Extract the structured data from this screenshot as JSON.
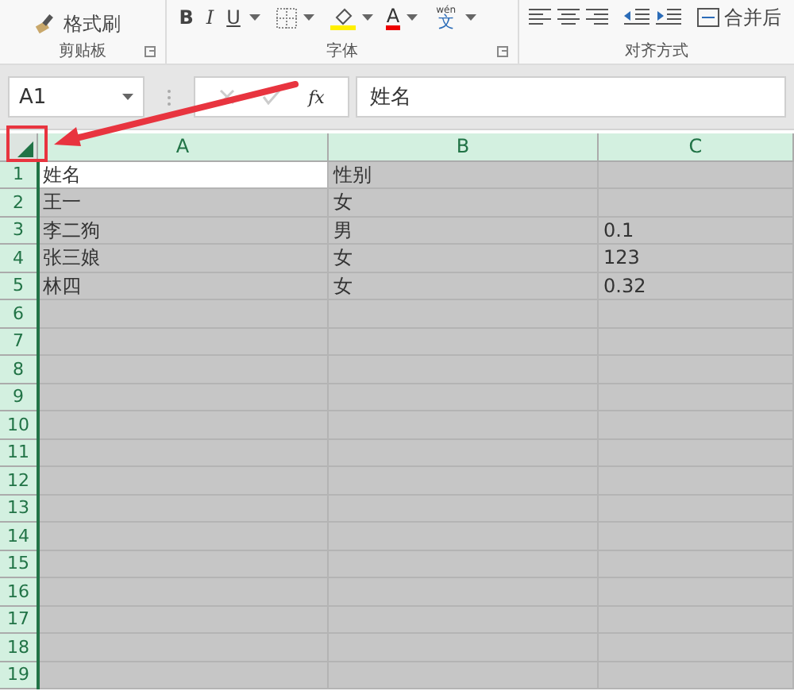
{
  "ribbon": {
    "format_painter": "格式刷",
    "bold": "B",
    "italic": "I",
    "underline": "U",
    "font_color": "A",
    "wen": "wén",
    "wen_char": "文",
    "merge": "合并后",
    "groups": [
      "剪贴板",
      "字体",
      "对齐方式"
    ]
  },
  "formula_bar": {
    "name_box": "A1",
    "fx": "fx",
    "value": "姓名"
  },
  "sheet": {
    "select_all": true,
    "columns": [
      {
        "label": "A"
      },
      {
        "label": "B"
      },
      {
        "label": "C"
      }
    ],
    "rows": [
      {
        "label": "1",
        "cells": [
          {
            "value": "姓名",
            "active": true
          },
          {
            "value": "性别",
            "active": false
          }
        ]
      },
      {
        "label": "2",
        "cells": [
          {
            "value": "王一",
            "active": false
          },
          {
            "value": "女",
            "active": false
          }
        ]
      },
      {
        "label": "3",
        "cells": [
          {
            "value": "李二狗",
            "active": false
          },
          {
            "value": "男",
            "active": false
          },
          {
            "value": "0.1",
            "active": false
          }
        ]
      },
      {
        "label": "4",
        "cells": [
          {
            "value": "张三娘",
            "active": false
          },
          {
            "value": "女",
            "active": false
          },
          {
            "value": "123",
            "active": false
          }
        ]
      },
      {
        "label": "5",
        "cells": [
          {
            "value": "林四",
            "active": false
          },
          {
            "value": "女",
            "active": false
          },
          {
            "value": "0.32",
            "active": false
          }
        ]
      },
      {
        "label": "6"
      },
      {
        "label": "7"
      },
      {
        "label": "8"
      },
      {
        "label": "9"
      },
      {
        "label": "10"
      },
      {
        "label": "11"
      },
      {
        "label": "12"
      },
      {
        "label": "13"
      },
      {
        "label": "14"
      },
      {
        "label": "15"
      },
      {
        "label": "16"
      },
      {
        "label": "17"
      },
      {
        "label": "18"
      },
      {
        "label": "19"
      }
    ]
  }
}
